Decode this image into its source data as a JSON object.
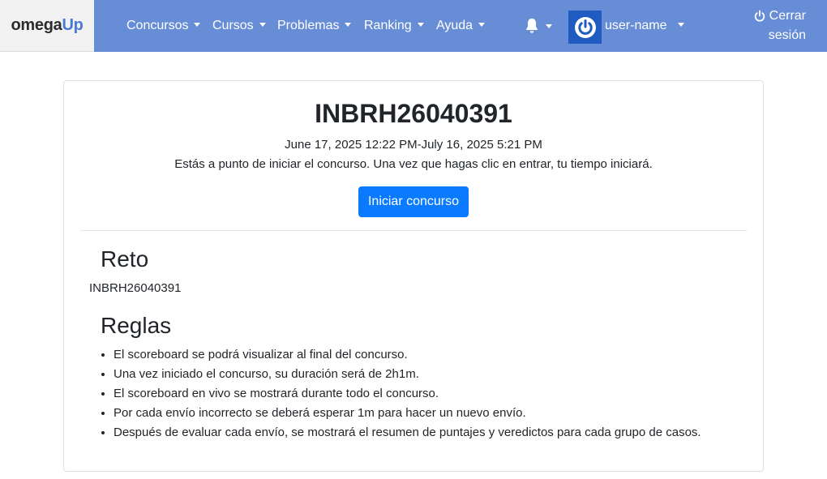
{
  "brand": {
    "part1": "omega",
    "part2": "Up"
  },
  "nav": {
    "items": [
      {
        "label": "Concursos"
      },
      {
        "label": "Cursos"
      },
      {
        "label": "Problemas"
      },
      {
        "label": "Ranking"
      },
      {
        "label": "Ayuda"
      }
    ],
    "bell_icon": "bell-icon",
    "username": "user-name",
    "logout_line1": "Cerrar",
    "logout_line2": "sesión"
  },
  "colors": {
    "navbar": "#678dd7",
    "primary_button": "#0a7bff",
    "avatar": "#1f5bc0"
  },
  "contest": {
    "title": "INBRH26040391",
    "dates": "June 17, 2025 12:22 PM-July 16, 2025 5:21 PM",
    "notice": "Estás a punto de iniciar el concurso. Una vez que hagas clic en entrar, tu tiempo iniciará.",
    "start_button": "Iniciar concurso",
    "challenge_heading": "Reto",
    "challenge_text": "INBRH26040391",
    "rules_heading": "Reglas",
    "rules": [
      "El scoreboard se podrá visualizar al final del concurso.",
      "Una vez iniciado el concurso, su duración será de 2h1m.",
      "El scoreboard en vivo se mostrará durante todo el concurso.",
      "Por cada envío incorrecto se deberá esperar 1m para hacer un nuevo envío.",
      "Después de evaluar cada envío, se mostrará el resumen de puntajes y veredictos para cada grupo de casos."
    ]
  }
}
